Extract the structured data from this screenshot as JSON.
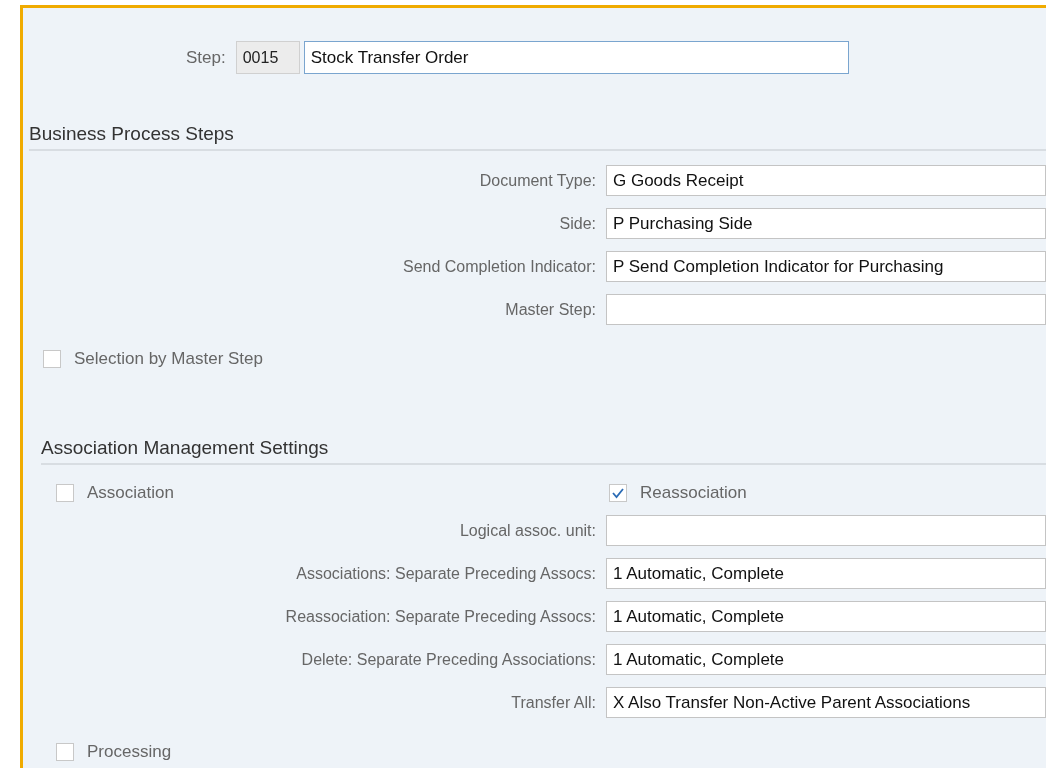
{
  "step": {
    "label": "Step:",
    "number": "0015",
    "description": "Stock Transfer Order"
  },
  "sections": [
    {
      "title": "Business Process Steps",
      "items": [
        {
          "kind": "field",
          "label": "Document Type:",
          "value": "G Goods Receipt"
        },
        {
          "kind": "field",
          "label": "Side:",
          "value": "P Purchasing Side"
        },
        {
          "kind": "field",
          "label": "Send Completion Indicator:",
          "value": "P Send Completion Indicator for Purchasing"
        },
        {
          "kind": "field",
          "label": "Master Step:",
          "value": ""
        },
        {
          "kind": "checkbox",
          "label": "Selection by Master Step",
          "checked": false
        }
      ]
    },
    {
      "title": "Association Management Settings",
      "items": [
        {
          "kind": "checkbox_pair",
          "boxes": [
            {
              "label": "Association",
              "checked": false
            },
            {
              "label": "Reassociation",
              "checked": true
            }
          ]
        },
        {
          "kind": "field",
          "label": "Logical assoc. unit:",
          "value": ""
        },
        {
          "kind": "field",
          "label": "Associations: Separate Preceding Assocs:",
          "value": "1 Automatic, Complete"
        },
        {
          "kind": "field",
          "label": "Reassociation: Separate Preceding Assocs:",
          "value": "1 Automatic, Complete"
        },
        {
          "kind": "field",
          "label": "Delete: Separate Preceding Associations:",
          "value": "1 Automatic, Complete"
        },
        {
          "kind": "field",
          "label": "Transfer All:",
          "value": "X Also Transfer Non-Active Parent Associations"
        },
        {
          "kind": "checkbox",
          "label": "Processing",
          "checked": false
        }
      ]
    }
  ]
}
